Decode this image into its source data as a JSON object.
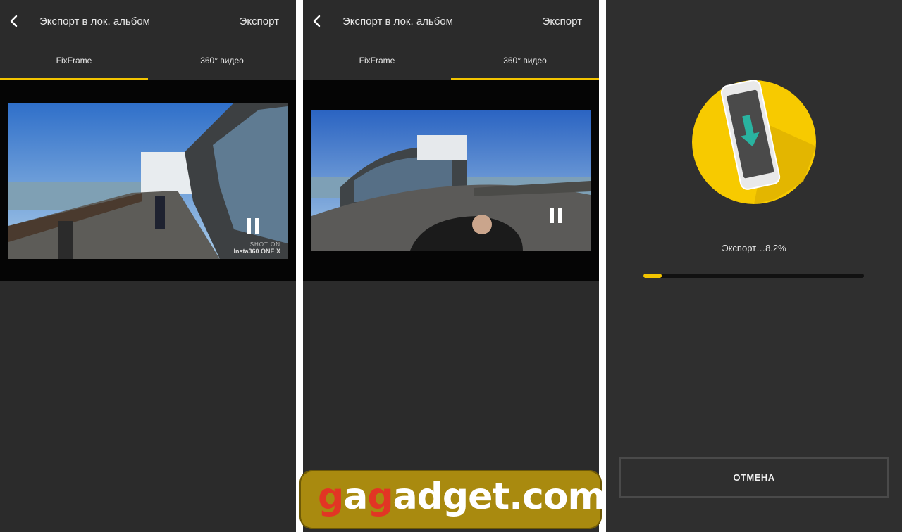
{
  "panels": [
    {
      "title": "Экспорт в лок. альбом",
      "export_label": "Экспорт",
      "tabs": [
        {
          "label": "FixFrame",
          "active": true
        },
        {
          "label": "360° видео",
          "active": false
        }
      ],
      "watermark": {
        "line1": "SHOT ON",
        "line2": "Insta360 ONE X"
      }
    },
    {
      "title": "Экспорт в лок. альбом",
      "export_label": "Экспорт",
      "tabs": [
        {
          "label": "FixFrame",
          "active": false
        },
        {
          "label": "360° видео",
          "active": true
        }
      ]
    },
    {
      "status_text": "Экспорт…8.2%",
      "progress_percent": 8.2,
      "cancel_label": "ОТМЕНА"
    }
  ],
  "logo": {
    "part1": "g",
    "part2": "a",
    "part3": "g",
    "part4": "adget.com"
  },
  "colors": {
    "accent": "#f2c400",
    "panel_bg": "#2b2b2b",
    "illus_green": "#29b3a0",
    "logo_bg": "#a98a0f",
    "logo_red": "#e23524"
  },
  "icons": [
    "back-icon",
    "pause-icon",
    "download-phone-illustration"
  ]
}
